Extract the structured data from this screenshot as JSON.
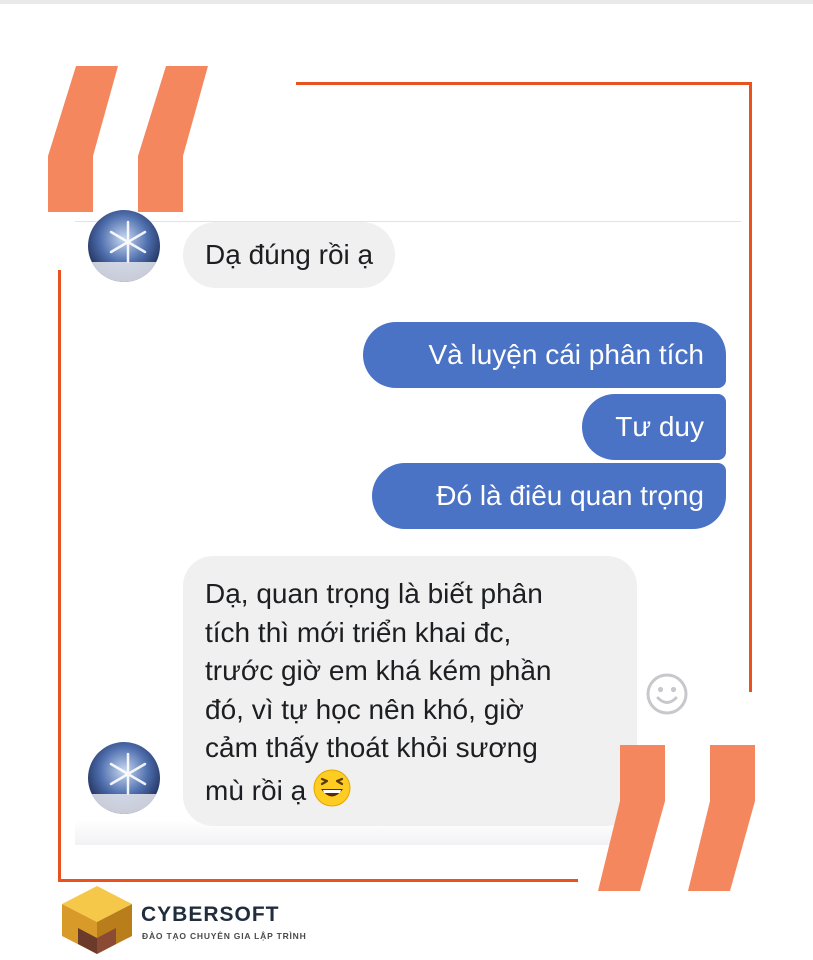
{
  "messages": {
    "m1": "Dạ đúng rồi ạ",
    "m2": "Và luyện cái phân tích",
    "m3": "Tư duy",
    "m4": "Đó là điêu quan trọng",
    "m5_lines": [
      "Dạ, quan trọng là biết phân",
      "tích thì mới triển khai đc,",
      "trước giờ em khá kém phần",
      "đó, vì tự học nên khó, giờ",
      "cảm thấy thoát khỏi sương",
      "mù rồi ạ"
    ]
  },
  "brand": {
    "name": "CYBERSOFT",
    "tagline": "ĐÀO TẠO CHUYÊN GIA LẬP TRÌNH"
  },
  "colors": {
    "accent_orange": "#e8521f",
    "quote_orange": "#f5875e",
    "outgoing_bubble": "#4a72c5",
    "incoming_bubble": "#f1f0f0"
  }
}
